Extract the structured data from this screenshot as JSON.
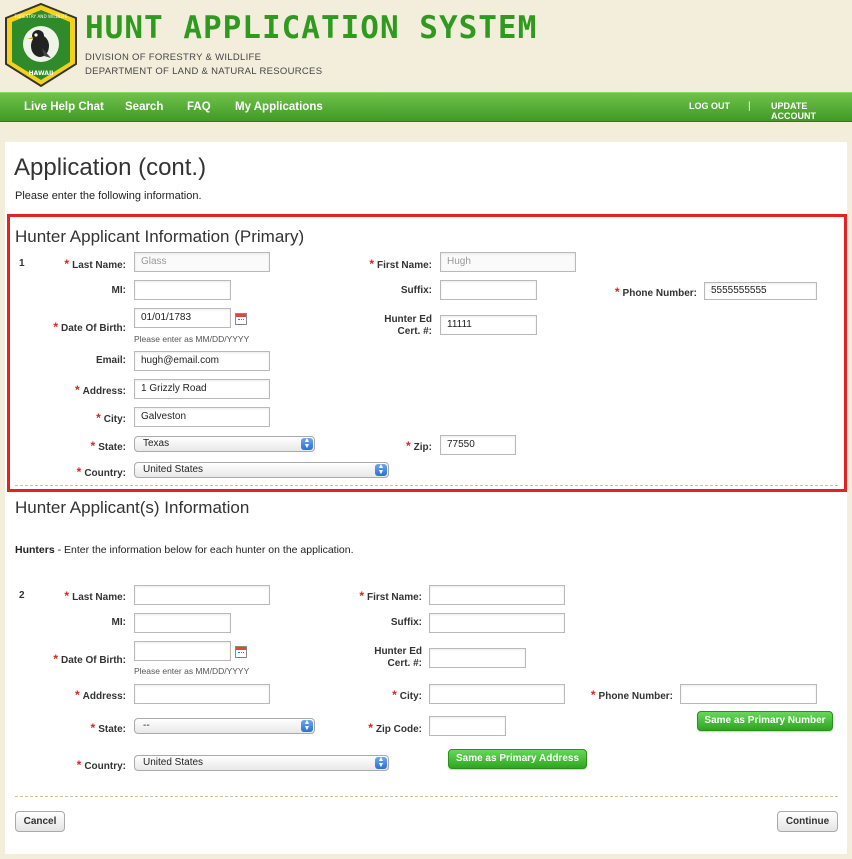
{
  "header": {
    "title": "HUNT APPLICATION SYSTEM",
    "division": "DIVISION OF FORESTRY & WILDLIFE",
    "department": "DEPARTMENT OF LAND & NATURAL RESOURCES",
    "logo_top_text": "FORESTRY AND WILDLIFE",
    "logo_bottom_text": "HAWAII",
    "brand_color": "#2f9a1f"
  },
  "nav": {
    "items": [
      "Live Help Chat",
      "Search",
      "FAQ",
      "My Applications"
    ],
    "logout": "LOG OUT",
    "separator": "|",
    "update_account": "UPDATE ACCOUNT"
  },
  "page": {
    "title": "Application (cont.)",
    "intro": "Please enter the following information."
  },
  "primary": {
    "heading": "Hunter Applicant Information (Primary)",
    "number": "1",
    "labels": {
      "last_name": "Last Name:",
      "first_name": "First Name:",
      "mi": "MI:",
      "suffix": "Suffix:",
      "phone": "Phone Number:",
      "dob": "Date Of Birth:",
      "hunter_ed_1": "Hunter Ed",
      "hunter_ed_2": "Cert. #:",
      "email": "Email:",
      "address": "Address:",
      "city": "City:",
      "state": "State:",
      "zip": "Zip:",
      "country": "Country:"
    },
    "values": {
      "last_name": "Glass",
      "first_name": "Hugh",
      "mi": "",
      "suffix": "",
      "phone": "5555555555",
      "dob": "01/01/1783",
      "hunter_ed": "11111",
      "email": "hugh@email.com",
      "address": "1 Grizzly Road",
      "city": "Galveston",
      "state": "Texas",
      "zip": "77550",
      "country": "United States"
    },
    "dob_hint": "Please enter as MM/DD/YYYY"
  },
  "secondary": {
    "heading": "Hunter Applicant(s) Information",
    "para_bold": "Hunters",
    "para_rest": " - Enter the information below for each hunter on the application.",
    "number": "2",
    "labels": {
      "last_name": "Last Name:",
      "first_name": "First Name:",
      "mi": "MI:",
      "suffix": "Suffix:",
      "dob": "Date Of Birth:",
      "hunter_ed_1": "Hunter Ed",
      "hunter_ed_2": "Cert. #:",
      "address": "Address:",
      "city": "City:",
      "phone": "Phone Number:",
      "state": "State:",
      "zip": "Zip Code:",
      "country": "Country:"
    },
    "values": {
      "state": "--",
      "country": "United States"
    },
    "dob_hint": "Please enter as MM/DD/YYYY",
    "same_number_button": "Same as Primary Number",
    "same_address_button": "Same as Primary Address"
  },
  "footer": {
    "cancel": "Cancel",
    "continue": "Continue"
  },
  "colors": {
    "highlight_border": "#e52222",
    "nav_green": "#3f9a25",
    "required": "#dd2222"
  }
}
